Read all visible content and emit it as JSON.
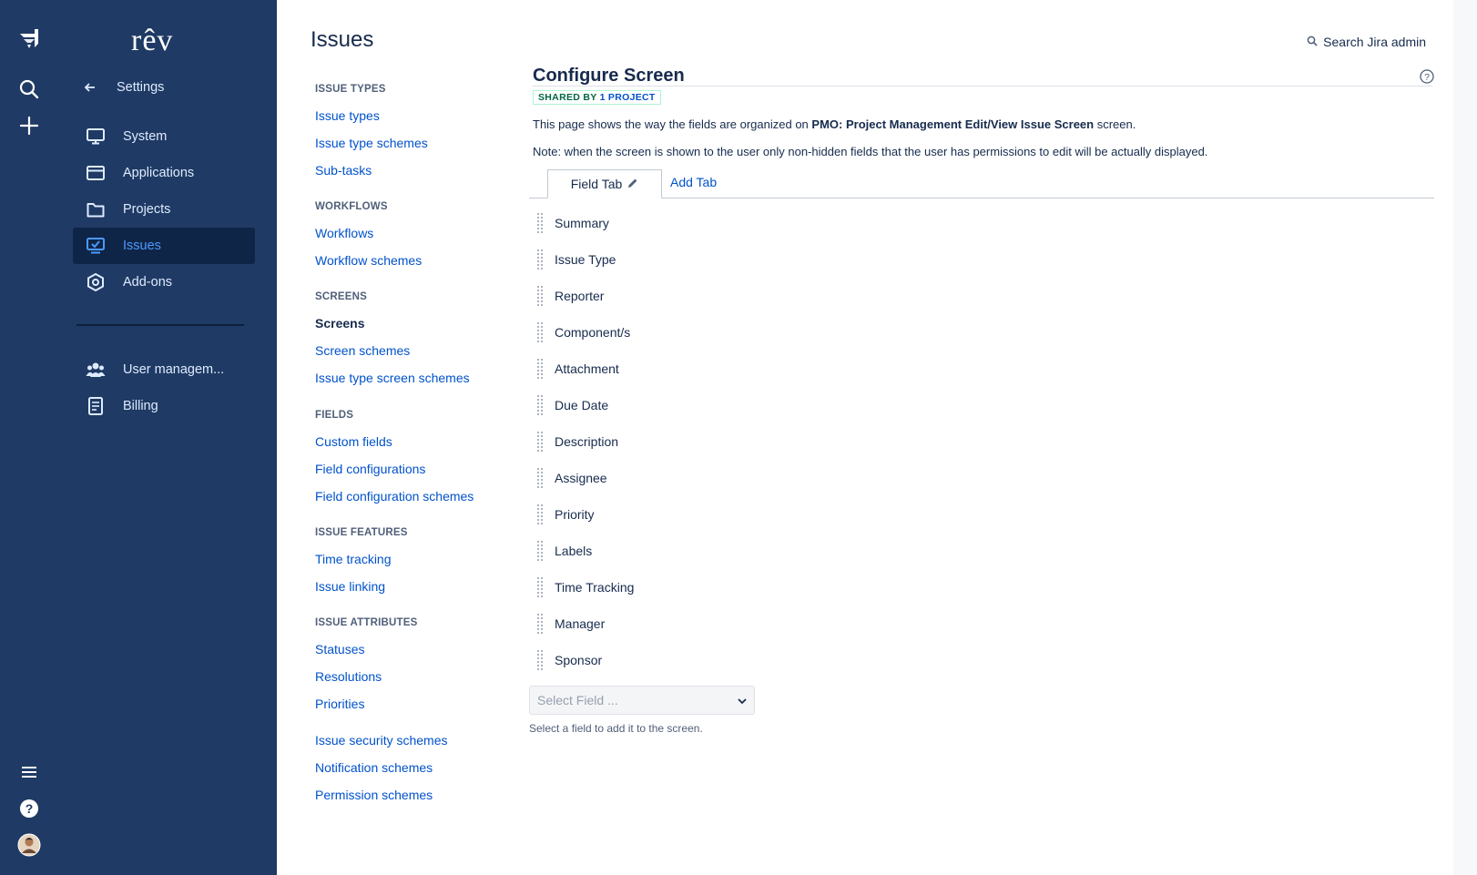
{
  "colors": {
    "sidebar_bg": "#1f3a64",
    "sidebar_active_bg": "#0f2547",
    "link": "#0052cc",
    "text": "#172b4d",
    "badge_green": "#006644"
  },
  "global_nav": {
    "icons": [
      "jira-logo-icon",
      "search-icon",
      "create-plus-icon",
      "menu-icon",
      "help-icon",
      "avatar"
    ]
  },
  "product_nav": {
    "brand": "rêv",
    "back_label": "Settings",
    "items": [
      {
        "label": "System",
        "icon": "monitor-icon"
      },
      {
        "label": "Applications",
        "icon": "window-icon"
      },
      {
        "label": "Projects",
        "icon": "folder-icon"
      },
      {
        "label": "Issues",
        "icon": "issues-icon",
        "active": true
      },
      {
        "label": "Add-ons",
        "icon": "addons-icon"
      }
    ],
    "secondary_items": [
      {
        "label": "User managem...",
        "icon": "users-icon"
      },
      {
        "label": "Billing",
        "icon": "billing-icon"
      }
    ]
  },
  "page": {
    "title": "Issues",
    "search_label": "Search Jira admin"
  },
  "admin_nav": {
    "sections": [
      {
        "heading": "ISSUE TYPES",
        "links": [
          "Issue types",
          "Issue type schemes",
          "Sub-tasks"
        ]
      },
      {
        "heading": "WORKFLOWS",
        "links": [
          "Workflows",
          "Workflow schemes"
        ]
      },
      {
        "heading": "SCREENS",
        "links": [
          "Screens",
          "Screen schemes",
          "Issue type screen schemes"
        ]
      },
      {
        "heading": "FIELDS",
        "links": [
          "Custom fields",
          "Field configurations",
          "Field configuration schemes"
        ]
      },
      {
        "heading": "ISSUE FEATURES",
        "links": [
          "Time tracking",
          "Issue linking"
        ]
      },
      {
        "heading": "ISSUE ATTRIBUTES",
        "links": [
          "Statuses",
          "Resolutions",
          "Priorities"
        ]
      },
      {
        "heading": "",
        "links": [
          "Issue security schemes",
          "Notification schemes",
          "Permission schemes"
        ]
      }
    ],
    "current": "Screens"
  },
  "configure_screen": {
    "title": "Configure Screen",
    "badge_prefix": "SHARED BY",
    "badge_link": "1 PROJECT",
    "desc_before": "This page shows the way the fields are organized on ",
    "desc_screen_name": "PMO: Project Management Edit/View Issue Screen",
    "desc_after": " screen.",
    "note": "Note: when the screen is shown to the user only non-hidden fields that the user has permissions to edit will be actually displayed.",
    "tab_active": "Field Tab",
    "tab_add": "Add Tab",
    "fields": [
      "Summary",
      "Issue Type",
      "Reporter",
      "Component/s",
      "Attachment",
      "Due Date",
      "Description",
      "Assignee",
      "Priority",
      "Labels",
      "Time Tracking",
      "Manager",
      "Sponsor"
    ],
    "select_placeholder": "Select Field ...",
    "select_hint": "Select a field to add it to the screen."
  }
}
